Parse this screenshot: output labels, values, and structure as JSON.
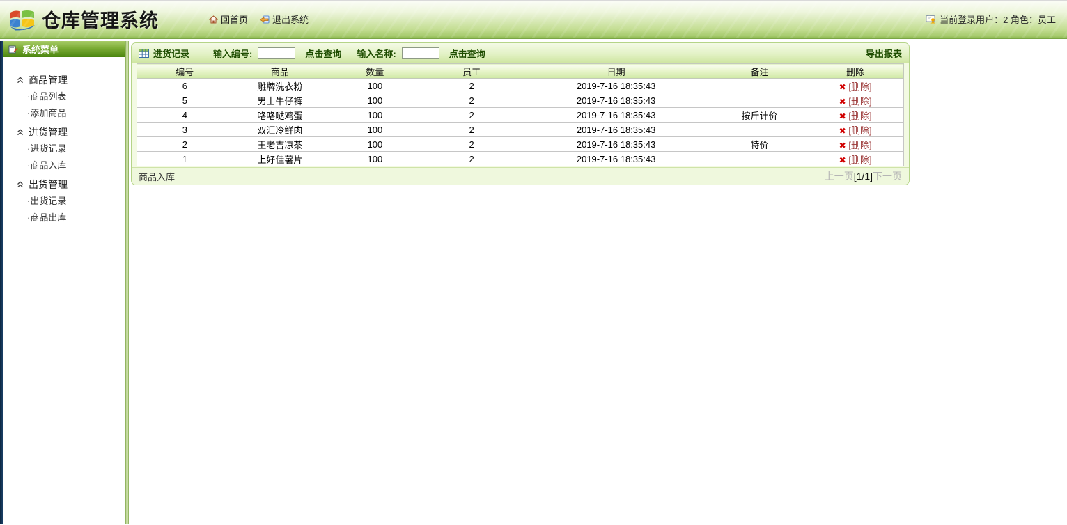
{
  "header": {
    "title": "仓库管理系统",
    "nav": {
      "home": "回首页",
      "logout": "退出系统"
    },
    "user_status": "当前登录用户：2 角色：员工"
  },
  "sidebar": {
    "header": "系统菜单",
    "groups": [
      {
        "label": "商品管理",
        "items": [
          "·商品列表",
          "·添加商品"
        ]
      },
      {
        "label": "进货管理",
        "items": [
          "·进货记录",
          "·商品入库"
        ]
      },
      {
        "label": "出货管理",
        "items": [
          "·出货记录",
          "·商品出库"
        ]
      }
    ]
  },
  "panel": {
    "title": "进货记录",
    "filters": {
      "id_label": "输入编号:",
      "id_value": "",
      "id_button": "点击查询",
      "name_label": "输入名称:",
      "name_value": "",
      "name_button": "点击查询"
    },
    "export_label": "导出报表",
    "table": {
      "columns": [
        "编号",
        "商品",
        "数量",
        "员工",
        "日期",
        "备注",
        "删除"
      ],
      "delete_icon": "✖",
      "delete_label": "[删除]",
      "rows": [
        {
          "id": "6",
          "product": "雕牌洗衣粉",
          "quantity": "100",
          "employee": "2",
          "date": "2019-7-16 18:35:43",
          "note": ""
        },
        {
          "id": "5",
          "product": "男士牛仔裤",
          "quantity": "100",
          "employee": "2",
          "date": "2019-7-16 18:35:43",
          "note": ""
        },
        {
          "id": "4",
          "product": "咯咯哒鸡蛋",
          "quantity": "100",
          "employee": "2",
          "date": "2019-7-16 18:35:43",
          "note": "按斤计价"
        },
        {
          "id": "3",
          "product": "双汇冷鲜肉",
          "quantity": "100",
          "employee": "2",
          "date": "2019-7-16 18:35:43",
          "note": ""
        },
        {
          "id": "2",
          "product": "王老吉凉茶",
          "quantity": "100",
          "employee": "2",
          "date": "2019-7-16 18:35:43",
          "note": "特价"
        },
        {
          "id": "1",
          "product": "上好佳薯片",
          "quantity": "100",
          "employee": "2",
          "date": "2019-7-16 18:35:43",
          "note": ""
        }
      ]
    },
    "footer": {
      "left_label": "商品入库",
      "prev": "上一页",
      "page": "[1/1]",
      "next": "下一页"
    }
  },
  "colors": {
    "accent_green": "#4a850f",
    "panel_border": "#b5d488",
    "delete_x_red": "#d10000",
    "delete_link_red": "#993333"
  }
}
